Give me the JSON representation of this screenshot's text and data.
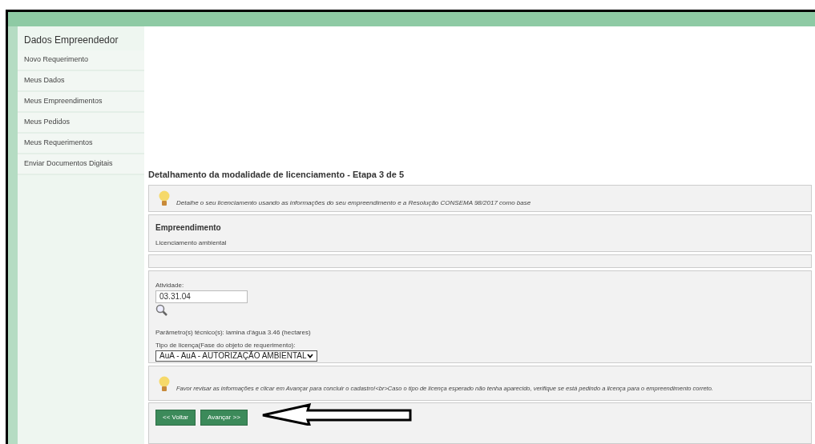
{
  "sidebar": {
    "title": "Dados Empreendedor",
    "items": [
      {
        "label": "Novo Requerimento"
      },
      {
        "label": "Meus Dados"
      },
      {
        "label": "Meus Empreendimentos"
      },
      {
        "label": "Meus Pedidos"
      },
      {
        "label": "Meus Requerimentos"
      },
      {
        "label": "Enviar Documentos Digitais"
      }
    ]
  },
  "heading": "Detalhamento da modalidade de licenciamento - Etapa 3 de 5",
  "tip_top": "Detalhe o seu licenciamento usando as informações do seu empreendimento e a Resolução CONSEMA 98/2017 como base",
  "empreendimento": {
    "title": "Empreendimento",
    "value": "Licenciamento ambiental"
  },
  "atividade": {
    "label": "Atividade:",
    "value": "03.31.04",
    "parametros": "Parâmetro(s) técnico(s): lamina d'água 3.46 (hectares)",
    "tipo_label": "Tipo de licença(Fase do objeto de requerimento):",
    "tipo_value": "AuA - AuA - AUTORIZAÇÃO AMBIENTAL"
  },
  "tip_bottom": "Favor revisar as informações e clicar em Avançar para concluir o cadastro!<br>Caso o tipo de licença esperado não tenha aparecido, verifique se está pedindo a licença para o empreendimento correto.",
  "buttons": [
    "<< Voltar",
    "Avançar >>"
  ]
}
